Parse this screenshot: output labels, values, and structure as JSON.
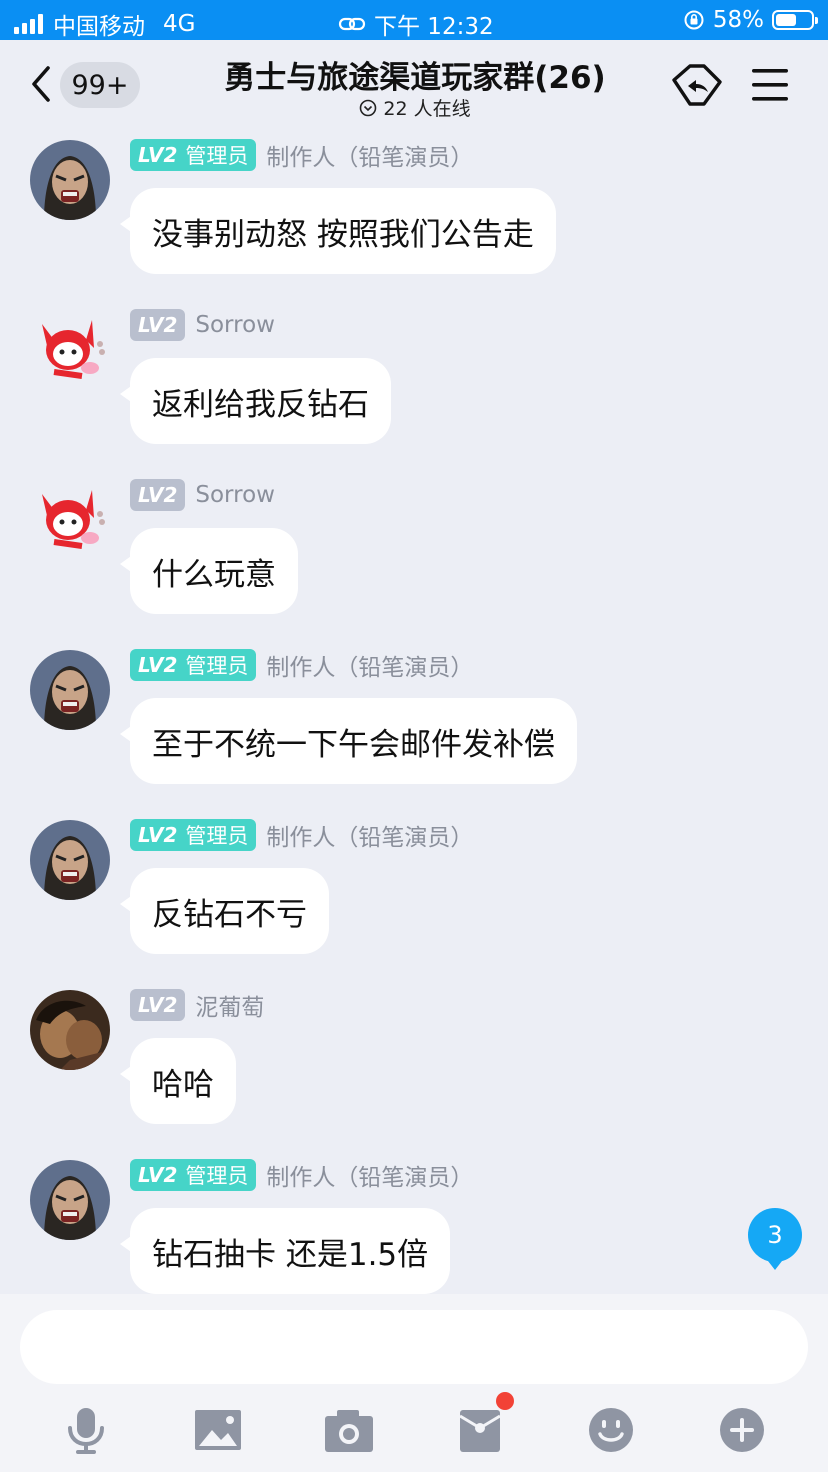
{
  "status_bar": {
    "carrier": "中国移动",
    "network": "4G",
    "time": "下午 12:32",
    "battery": "58%",
    "battery_level": 0.58
  },
  "header": {
    "back_badge": "99+",
    "title": "勇士与旅途渠道玩家群(26)",
    "online": "22 人在线"
  },
  "messages": [
    {
      "level": "LV2",
      "role": "管理员",
      "nickname": "制作人（铅笔演员）",
      "text": "没事别动怒 按照我们公告走",
      "avatar": "warrior-avatar"
    },
    {
      "level": "LV2",
      "role": "",
      "nickname": "Sorrow",
      "text": "返利给我反钻石",
      "avatar": "red-fox-avatar"
    },
    {
      "level": "LV2",
      "role": "",
      "nickname": "Sorrow",
      "text": "什么玩意",
      "avatar": "red-fox-avatar"
    },
    {
      "level": "LV2",
      "role": "管理员",
      "nickname": "制作人（铅笔演员）",
      "text": "至于不统一下午会邮件发补偿",
      "avatar": "warrior-avatar"
    },
    {
      "level": "LV2",
      "role": "管理员",
      "nickname": "制作人（铅笔演员）",
      "text": "反钻石不亏",
      "avatar": "warrior-avatar"
    },
    {
      "level": "LV2",
      "role": "",
      "nickname": "泥葡萄",
      "text": "哈哈",
      "avatar": "photo-avatar"
    },
    {
      "level": "LV2",
      "role": "管理员",
      "nickname": "制作人（铅笔演员）",
      "text": "钻石抽卡 还是1.5倍",
      "avatar": "warrior-avatar"
    }
  ],
  "unread_count": "3",
  "toolbar": [
    "microphone-icon",
    "image-icon",
    "camera-icon",
    "red-packet-icon",
    "emoji-icon",
    "plus-icon"
  ],
  "colors": {
    "status_bar": "#0a8ff3",
    "background": "#eceef5",
    "admin_tag": "#46d4c8",
    "level_tag": "#b9bfce",
    "unread_badge": "#15a8f5",
    "notification_dot": "#f24236"
  }
}
